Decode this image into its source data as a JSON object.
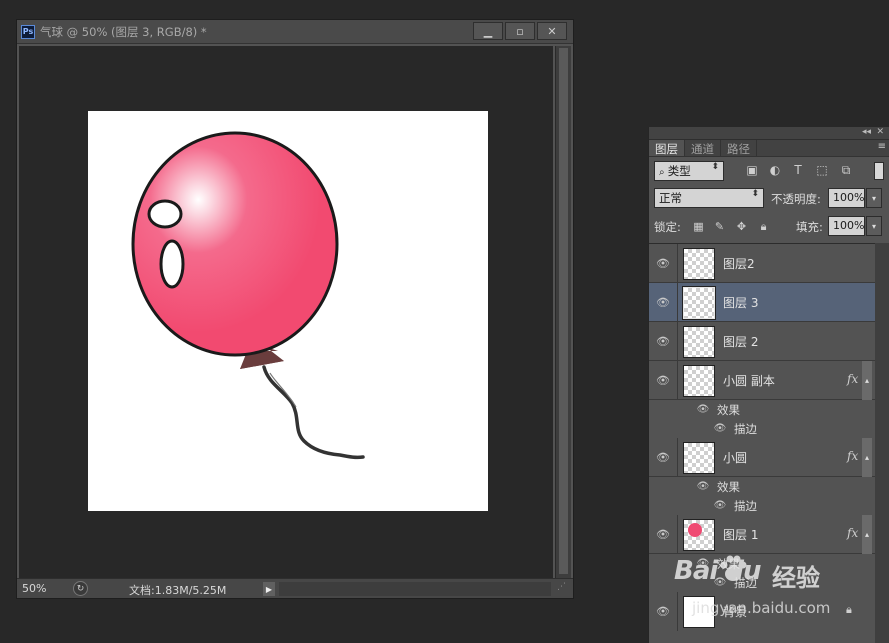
{
  "document": {
    "title": "气球 @ 50% (图层 3, RGB/8) *",
    "app_badge": "Ps",
    "zoom": "50%",
    "doc_info": "文档:1.83M/5.25M"
  },
  "panel": {
    "tabs": [
      "图层",
      "通道",
      "路径"
    ],
    "filter_kind": "类型",
    "blend_mode": "正常",
    "opacity_label": "不透明度:",
    "opacity_value": "100%",
    "lock_label": "锁定:",
    "fill_label": "填充:",
    "fill_value": "100%"
  },
  "layers": [
    {
      "name": "图层2",
      "selected": false,
      "fx": false
    },
    {
      "name": "图层 3",
      "selected": true,
      "fx": false
    },
    {
      "name": "图层 2",
      "selected": false,
      "fx": false
    },
    {
      "name": "小圆 副本",
      "selected": false,
      "fx": true,
      "effects_label": "效果",
      "effect": "描边"
    },
    {
      "name": "小圆",
      "selected": false,
      "fx": true,
      "effects_label": "效果",
      "effect": "描边"
    },
    {
      "name": "图层 1",
      "selected": false,
      "fx": true,
      "effects_label": "效果",
      "effect": "描边"
    },
    {
      "name": "背景",
      "selected": false,
      "fx": false,
      "locked": true
    }
  ],
  "watermark": {
    "brand": "Bai  du",
    "jingyan": "经验",
    "url": "jingyan.baidu.com"
  },
  "colors": {
    "balloon": "#f24a70",
    "selected_layer": "#566378",
    "knot": "#6a3d3d"
  }
}
